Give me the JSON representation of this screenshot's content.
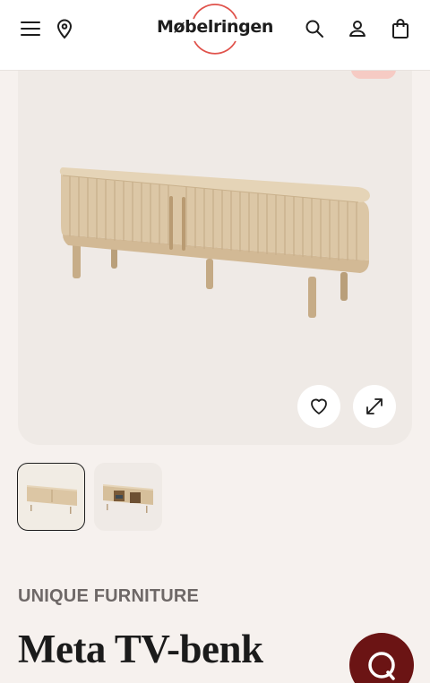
{
  "header": {
    "logo_text": "Møbelringen",
    "icons": {
      "menu": "menu-icon",
      "location": "location-pin-icon",
      "search": "search-icon",
      "account": "user-icon",
      "cart": "shopping-bag-icon"
    },
    "logo_ring_color": "#e0524b"
  },
  "gallery": {
    "image_count": 2,
    "selected_index": 0,
    "actions": {
      "favorite": "heart-icon",
      "fullscreen": "expand-icon"
    }
  },
  "product": {
    "brand": "UNIQUE FURNITURE",
    "name": "Meta TV-benk"
  },
  "chat": {
    "icon": "chat-icon",
    "color": "#6b1414"
  }
}
